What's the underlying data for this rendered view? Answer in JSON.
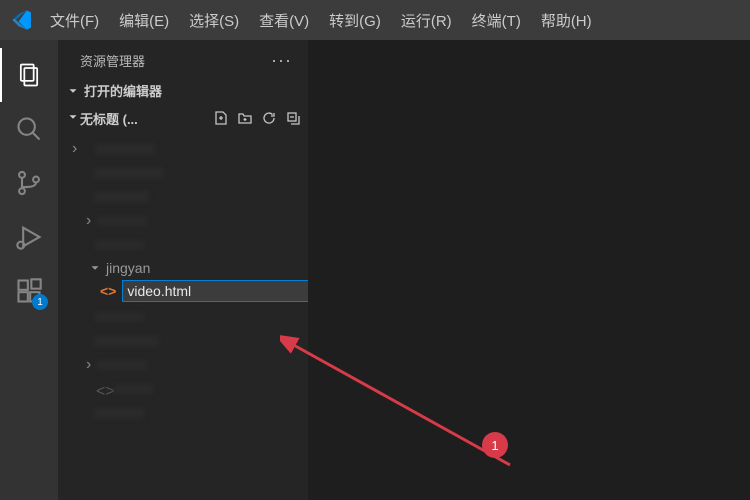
{
  "menu": {
    "file": "文件(F)",
    "edit": "编辑(E)",
    "select": "选择(S)",
    "view": "查看(V)",
    "goto": "转到(G)",
    "run": "运行(R)",
    "terminal": "终端(T)",
    "help": "帮助(H)"
  },
  "sidebar": {
    "title": "资源管理器",
    "openEditors": "打开的编辑器",
    "workspace": "无标题 (...",
    "folder": "jingyan",
    "inputValue": "video.html"
  },
  "badges": {
    "extensions": "1"
  },
  "annotation": {
    "label": "1"
  }
}
